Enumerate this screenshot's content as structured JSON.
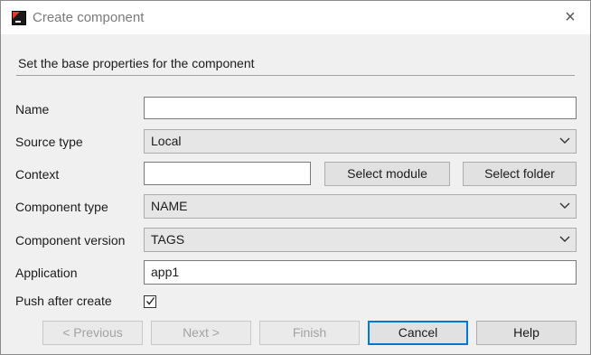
{
  "window": {
    "title": "Create component",
    "close_label": "×"
  },
  "header": {
    "subtitle": "Set the base properties for the component"
  },
  "form": {
    "name": {
      "label": "Name",
      "value": ""
    },
    "source_type": {
      "label": "Source type",
      "value": "Local"
    },
    "context": {
      "label": "Context",
      "value": "",
      "select_module_label": "Select module",
      "select_folder_label": "Select folder"
    },
    "component_type": {
      "label": "Component type",
      "value": "NAME"
    },
    "component_version": {
      "label": "Component version",
      "value": "TAGS"
    },
    "application": {
      "label": "Application",
      "value": "app1"
    },
    "push_after_create": {
      "label": "Push after create",
      "checked": true
    }
  },
  "footer": {
    "previous_label": "< Previous",
    "next_label": "Next >",
    "finish_label": "Finish",
    "cancel_label": "Cancel",
    "help_label": "Help"
  },
  "colors": {
    "accent": "#0078d7",
    "disabled_text": "#a3a3a3"
  }
}
